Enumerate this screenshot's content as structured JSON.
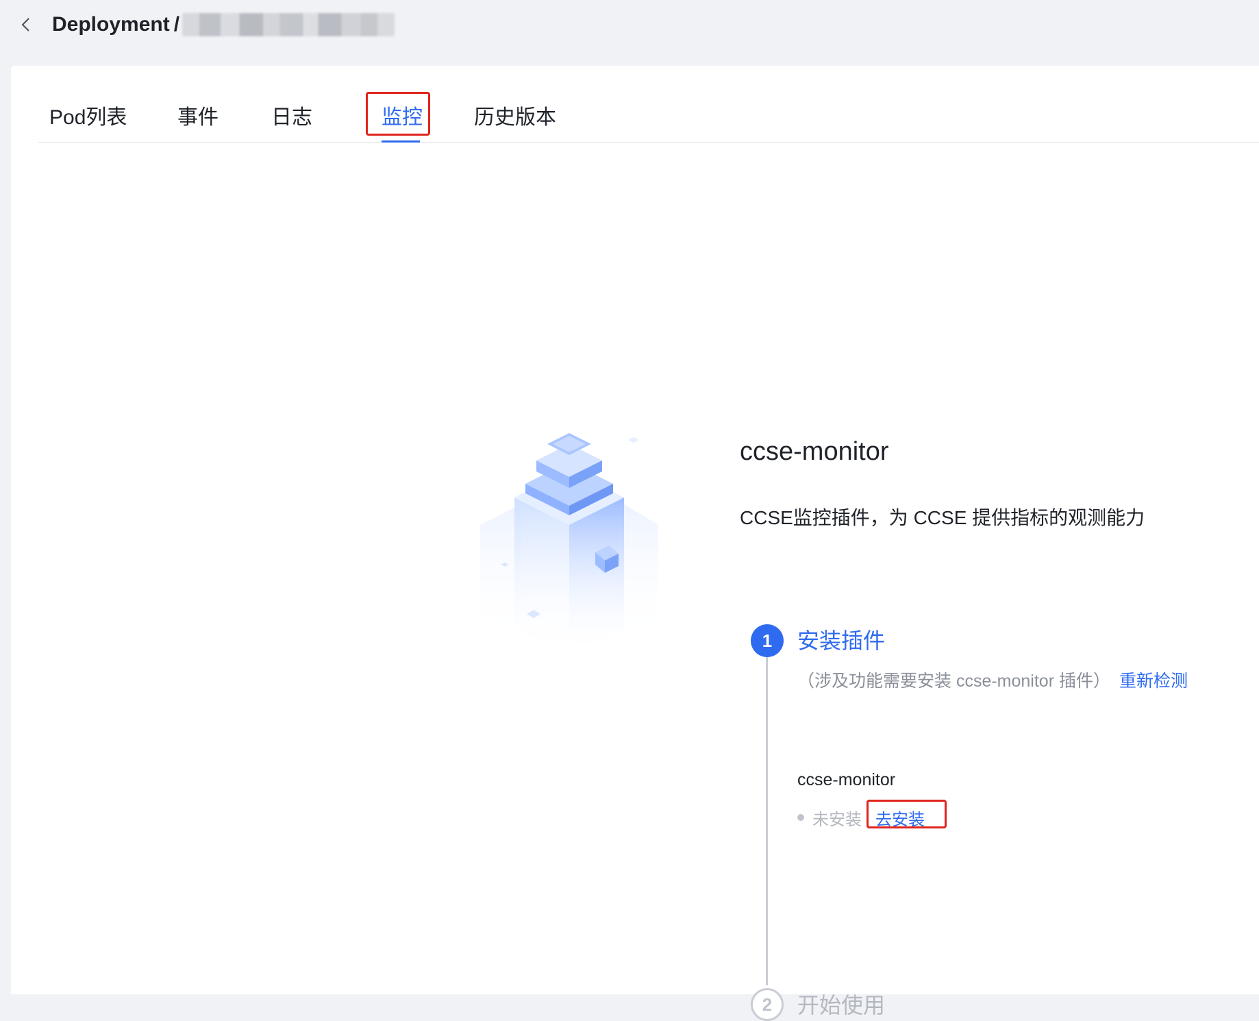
{
  "header": {
    "breadcrumb_type": "Deployment",
    "breadcrumb_separator": "/",
    "back_icon": "chevron-left-icon"
  },
  "tabs": [
    {
      "label": "Pod列表",
      "active": false
    },
    {
      "label": "事件",
      "active": false
    },
    {
      "label": "日志",
      "active": false
    },
    {
      "label": "监控",
      "active": true
    },
    {
      "label": "历史版本",
      "active": false
    }
  ],
  "plugin": {
    "title": "ccse-monitor",
    "description": "CCSE监控插件，为 CCSE 提供指标的观测能力"
  },
  "steps": [
    {
      "number": "1",
      "title": "安装插件",
      "note": "（涉及功能需要安装 ccse-monitor 插件）",
      "recheck_label": "重新检测",
      "plugin_name": "ccse-monitor",
      "status": "未安装",
      "install_label": "去安装"
    },
    {
      "number": "2",
      "title": "开始使用"
    }
  ],
  "colors": {
    "accent": "#2f6bf0",
    "highlight": "#e0241d",
    "muted": "#b4b8bf"
  }
}
